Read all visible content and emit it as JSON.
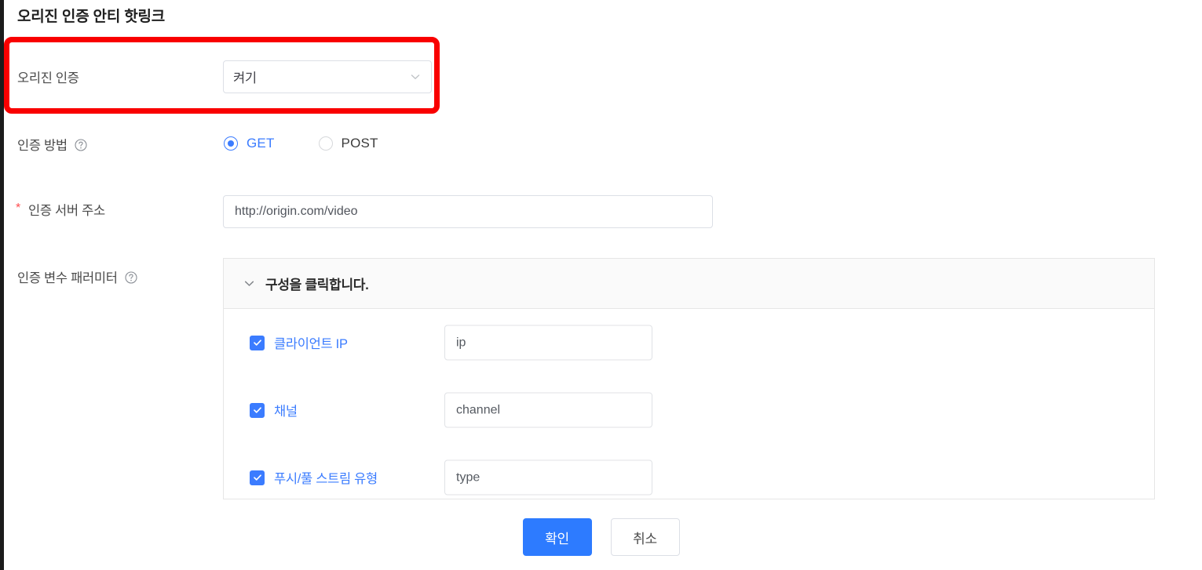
{
  "dialog": {
    "title": "오리진 인증 안티 핫링크"
  },
  "colors": {
    "accent": "#3b7cff",
    "primary_button": "#2d7bff",
    "annotation": "#f90000",
    "border": "#dcdfe6",
    "panel_header_bg": "#fafafa",
    "label_text": "#4a4a4a"
  },
  "rows": {
    "auth_toggle": {
      "label": "오리진 인증",
      "value": "켜기",
      "chevron_icon": "chevron-down-icon"
    },
    "auth_method": {
      "label": "인증 방법",
      "help_icon": "help-circle-icon",
      "options": [
        {
          "label": "GET",
          "checked": true
        },
        {
          "label": "POST",
          "checked": false
        }
      ]
    },
    "auth_server": {
      "required_mark": "*",
      "label": "인증 서버 주소",
      "value": "http://origin.com/video",
      "placeholder": "http://origin.com/video"
    },
    "auth_params": {
      "label": "인증 변수 패러미터",
      "help_icon": "help-circle-icon",
      "panel": {
        "header_title": "구성을 클릭합니다.",
        "header_icon": "chevron-down-icon",
        "items": [
          {
            "label": "클라이언트 IP",
            "checked": true,
            "value": "ip",
            "placeholder": "ip"
          },
          {
            "label": "채널",
            "checked": true,
            "value": "channel",
            "placeholder": "channel"
          },
          {
            "label": "푸시/풀 스트림 유형",
            "checked": true,
            "value": "type",
            "placeholder": "type"
          }
        ]
      }
    }
  },
  "footer": {
    "confirm_label": "확인",
    "cancel_label": "취소"
  }
}
